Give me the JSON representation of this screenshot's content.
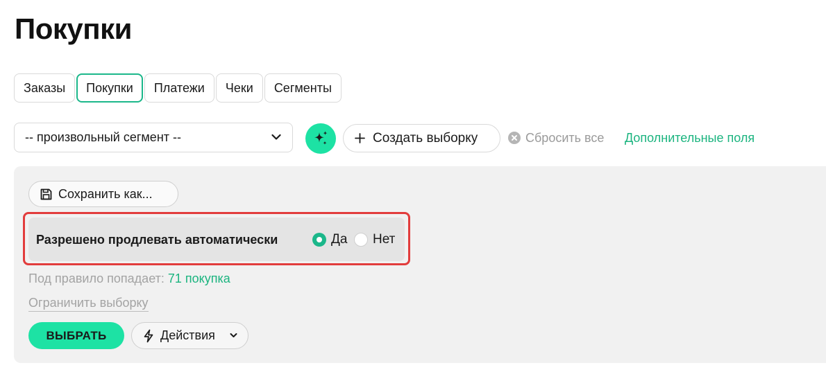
{
  "page": {
    "title": "Покупки"
  },
  "tabs": [
    {
      "label": "Заказы",
      "active": false
    },
    {
      "label": "Покупки",
      "active": true
    },
    {
      "label": "Платежи",
      "active": false
    },
    {
      "label": "Чеки",
      "active": false
    },
    {
      "label": "Сегменты",
      "active": false
    }
  ],
  "toolbar": {
    "segment_select_value": "-- произвольный сегмент --",
    "segment_select_icon": "chevron-down-icon",
    "ai_button_icon": "sparkles-icon",
    "create_selection_label": "Создать выборку",
    "create_selection_icon": "plus-icon",
    "reset_all_label": "Сбросить все",
    "reset_all_icon": "close-circle-icon",
    "extra_fields_label": "Дополнительные поля"
  },
  "filter_panel": {
    "save_as_label": "Сохранить как...",
    "save_as_icon": "floppy-disk-icon",
    "rule": {
      "label": "Разрешено продлевать автоматически",
      "options": [
        {
          "label": "Да",
          "checked": true
        },
        {
          "label": "Нет",
          "checked": false
        }
      ]
    },
    "match_prefix": "Под правило попадает:",
    "match_count": "71 покупка",
    "limit_selection_label": "Ограничить выборку",
    "select_button_label": "ВЫБРАТЬ",
    "actions_label": "Действия",
    "actions_icon": "lightning-icon"
  },
  "colors": {
    "accent": "#1de2a4",
    "accent_text": "#1bb47f",
    "highlight_border": "#e23c3c",
    "panel_bg": "#f1f1f1"
  }
}
